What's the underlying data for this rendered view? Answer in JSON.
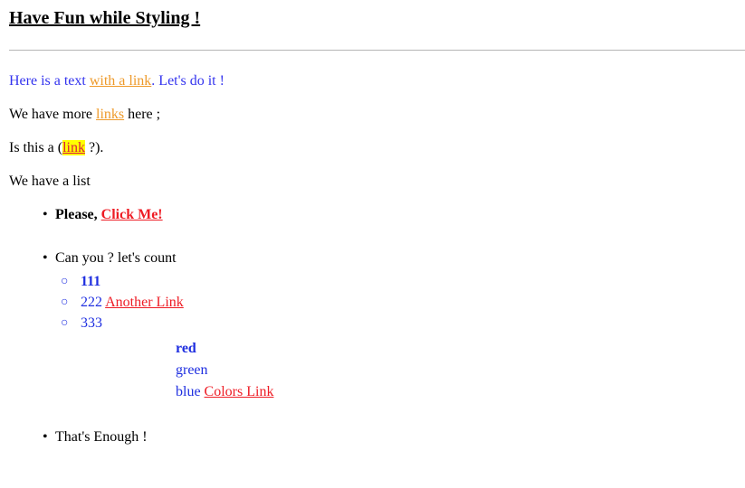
{
  "heading": "Have Fun while Styling !",
  "paragraphs": {
    "p1_before": "Here is a text ",
    "p1_link": "with a link",
    "p1_after": ". Let's do it !",
    "p2_before": "We have more ",
    "p2_link": "links",
    "p2_after": " here ;",
    "p3_before": "Is this a (",
    "p3_link": "link",
    "p3_after": " ?).",
    "p4": "We have a list"
  },
  "list": {
    "bullet": "•",
    "circle": "○",
    "item1_label": "Please, ",
    "item1_link": "Click Me!",
    "item2_label": "Can you ? let's count",
    "sub1": "111",
    "sub2_label": "222 ",
    "sub2_link": "Another Link",
    "sub3": "333",
    "color_red": "red",
    "color_green": "green",
    "color_blue_label": "blue ",
    "color_blue_link": "Colors Link",
    "item3_label": "That's Enough !"
  },
  "colors": {
    "blue_text": "#3333ee",
    "orange_link": "#ee9a2a",
    "red_link": "#ee1c25",
    "highlight": "#ffff00"
  }
}
